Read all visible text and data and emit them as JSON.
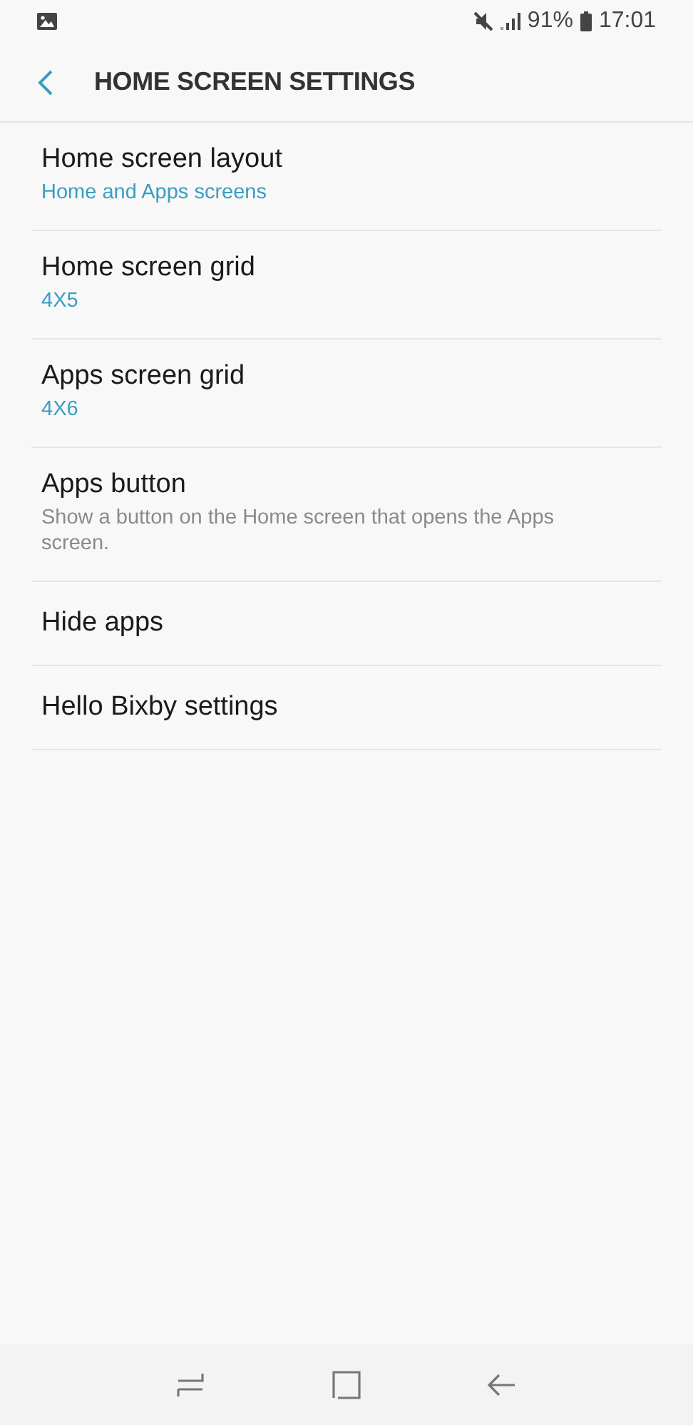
{
  "status_bar": {
    "battery": "91%",
    "time": "17:01"
  },
  "header": {
    "title": "HOME SCREEN SETTINGS"
  },
  "items": [
    {
      "title": "Home screen layout",
      "kind": "value",
      "subtitle": "Home and Apps screens"
    },
    {
      "title": "Home screen grid",
      "kind": "value",
      "subtitle": "4X5"
    },
    {
      "title": "Apps screen grid",
      "kind": "value",
      "subtitle": "4X6"
    },
    {
      "title": "Apps button",
      "kind": "description",
      "subtitle": "Show a button on the Home screen that opens the Apps screen."
    },
    {
      "title": "Hide apps",
      "kind": "plain"
    },
    {
      "title": "Hello Bixby settings",
      "kind": "plain"
    }
  ]
}
